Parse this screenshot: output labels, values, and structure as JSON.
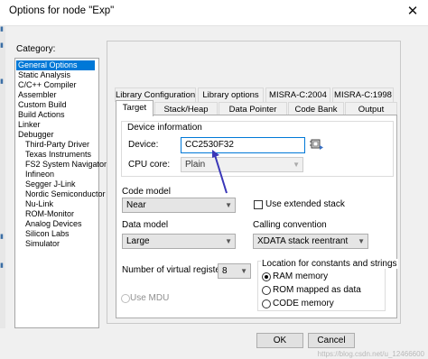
{
  "window": {
    "title": "Options for node \"Exp\"",
    "close_icon": "close-icon"
  },
  "category": {
    "label": "Category:",
    "items": [
      {
        "label": "General Options",
        "selected": true
      },
      {
        "label": "Static Analysis"
      },
      {
        "label": "C/C++ Compiler"
      },
      {
        "label": "Assembler"
      },
      {
        "label": "Custom Build"
      },
      {
        "label": "Build Actions"
      },
      {
        "label": "Linker"
      },
      {
        "label": "Debugger"
      },
      {
        "label": "Third-Party Driver"
      },
      {
        "label": "Texas Instruments"
      },
      {
        "label": "FS2 System Navigator"
      },
      {
        "label": "Infineon"
      },
      {
        "label": "Segger J-Link"
      },
      {
        "label": "Nordic Semiconductor"
      },
      {
        "label": "Nu-Link"
      },
      {
        "label": "ROM-Monitor"
      },
      {
        "label": "Analog Devices"
      },
      {
        "label": "Silicon Labs"
      },
      {
        "label": "Simulator"
      }
    ]
  },
  "tabs_row1": [
    "Library Configuration",
    "Library options",
    "MISRA-C:2004",
    "MISRA-C:1998"
  ],
  "tabs_row2": [
    "Target",
    "Stack/Heap",
    "Data Pointer",
    "Code Bank",
    "Output"
  ],
  "active_tab": "Target",
  "device_info": {
    "group_label": "Device information",
    "device_label": "Device:",
    "device_value": "CC2530F32",
    "cpu_label": "CPU core:",
    "cpu_value": "Plain"
  },
  "code_model": {
    "label": "Code model",
    "value": "Near"
  },
  "extended_stack": {
    "label": "Use extended stack",
    "checked": false
  },
  "data_model": {
    "label": "Data model",
    "value": "Large"
  },
  "calling_convention": {
    "label": "Calling convention",
    "value": "XDATA stack reentrant"
  },
  "virtual_registers": {
    "label": "Number of virtual registers:",
    "value": "8"
  },
  "mdu": {
    "label": "Use MDU",
    "enabled": false
  },
  "location": {
    "group_label": "Location for constants and strings",
    "options": [
      {
        "label": "RAM memory",
        "selected": true
      },
      {
        "label": "ROM mapped as data",
        "selected": false
      },
      {
        "label": "CODE memory",
        "selected": false
      }
    ]
  },
  "buttons": {
    "ok": "OK",
    "cancel": "Cancel"
  },
  "watermark": "https://blog.csdn.net/u_12466600",
  "colors": {
    "selection": "#0078d7",
    "annotation_arrow": "#3a37b8"
  }
}
